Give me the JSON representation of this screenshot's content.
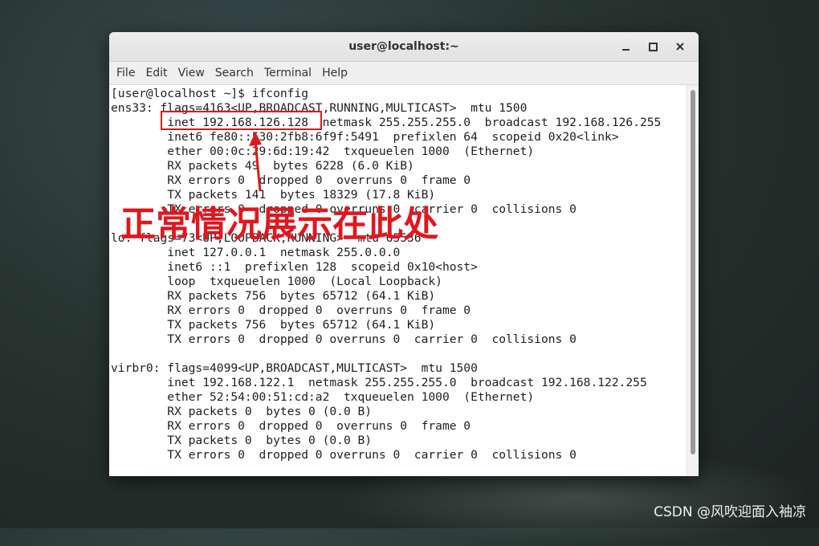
{
  "window": {
    "title": "user@localhost:~"
  },
  "menu": [
    "File",
    "Edit",
    "View",
    "Search",
    "Terminal",
    "Help"
  ],
  "terminal": {
    "lines": [
      "[user@localhost ~]$ ifconfig",
      "ens33: flags=4163<UP,BROADCAST,RUNNING,MULTICAST>  mtu 1500",
      "        inet 192.168.126.128  netmask 255.255.255.0  broadcast 192.168.126.255",
      "        inet6 fe80::530:2fb8:6f9f:5491  prefixlen 64  scopeid 0x20<link>",
      "        ether 00:0c:29:6d:19:42  txqueuelen 1000  (Ethernet)",
      "        RX packets 49  bytes 6228 (6.0 KiB)",
      "        RX errors 0  dropped 0  overruns 0  frame 0",
      "        TX packets 141  bytes 18329 (17.8 KiB)",
      "        TX errors 0  dropped 0 overruns 0  carrier 0  collisions 0",
      "",
      "lo: flags=73<UP,LOOPBACK,RUNNING>  mtu 65536",
      "        inet 127.0.0.1  netmask 255.0.0.0",
      "        inet6 ::1  prefixlen 128  scopeid 0x10<host>",
      "        loop  txqueuelen 1000  (Local Loopback)",
      "        RX packets 756  bytes 65712 (64.1 KiB)",
      "        RX errors 0  dropped 0  overruns 0  frame 0",
      "        TX packets 756  bytes 65712 (64.1 KiB)",
      "        TX errors 0  dropped 0 overruns 0  carrier 0  collisions 0",
      "",
      "virbr0: flags=4099<UP,BROADCAST,MULTICAST>  mtu 1500",
      "        inet 192.168.122.1  netmask 255.255.255.0  broadcast 192.168.122.255",
      "        ether 52:54:00:51:cd:a2  txqueuelen 1000  (Ethernet)",
      "        RX packets 0  bytes 0 (0.0 B)",
      "        RX errors 0  dropped 0  overruns 0  frame 0",
      "        TX packets 0  bytes 0 (0.0 B)",
      "        TX errors 0  dropped 0 overruns 0  carrier 0  collisions 0"
    ]
  },
  "annotation": {
    "text": "正常情况展示在此处",
    "color": "#e0171e"
  },
  "watermark": "CSDN @风吹迎面入袖凉"
}
